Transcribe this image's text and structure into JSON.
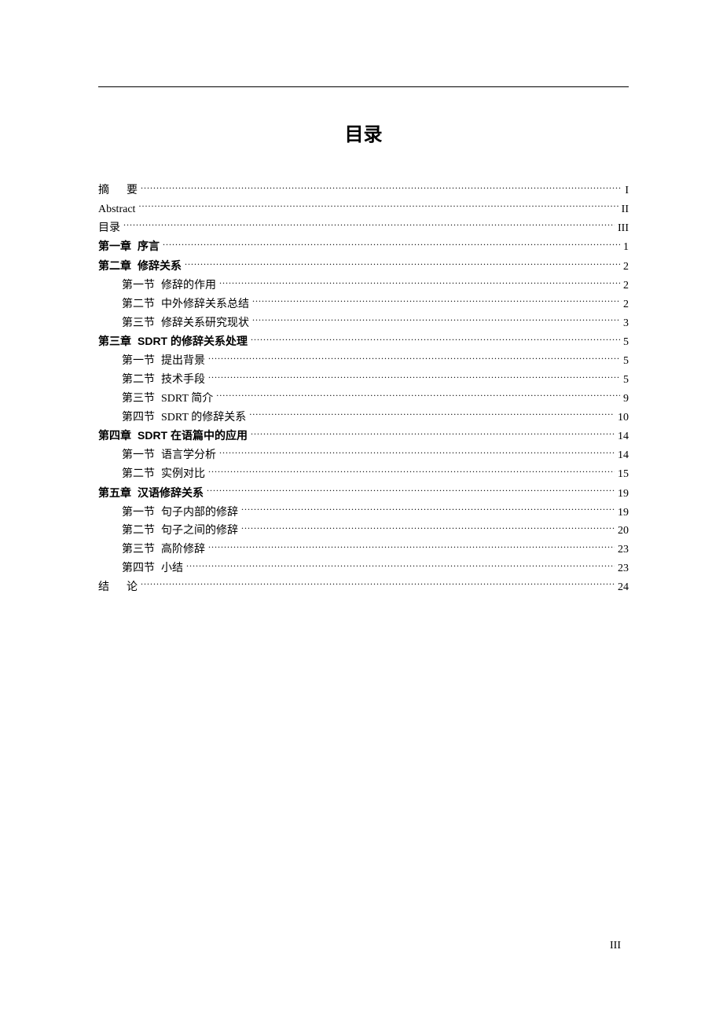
{
  "title": "目录",
  "page_number": "III",
  "entries": [
    {
      "label": "摘",
      "text": "要",
      "page": "I",
      "indent": 0,
      "bold": false,
      "spaced": true
    },
    {
      "label": "Abstract",
      "text": "",
      "page": "II",
      "indent": 0,
      "bold": false,
      "spaced": false
    },
    {
      "label": "目录",
      "text": "",
      "page": "III",
      "indent": 0,
      "bold": false,
      "spaced": false
    },
    {
      "label": "第一章",
      "text": "序言",
      "page": "1",
      "indent": 0,
      "bold": true,
      "spaced": false
    },
    {
      "label": "第二章",
      "text": "修辞关系",
      "page": "2",
      "indent": 0,
      "bold": true,
      "spaced": false
    },
    {
      "label": "第一节",
      "text": "修辞的作用",
      "page": "2",
      "indent": 1,
      "bold": false,
      "spaced": false
    },
    {
      "label": "第二节",
      "text": "中外修辞关系总结",
      "page": "2",
      "indent": 1,
      "bold": false,
      "spaced": false
    },
    {
      "label": "第三节",
      "text": "修辞关系研究现状",
      "page": "3",
      "indent": 1,
      "bold": false,
      "spaced": false
    },
    {
      "label": "第三章",
      "text": "SDRT 的修辞关系处理",
      "page": "5",
      "indent": 0,
      "bold": true,
      "spaced": false
    },
    {
      "label": "第一节",
      "text": "提出背景",
      "page": "5",
      "indent": 1,
      "bold": false,
      "spaced": false
    },
    {
      "label": "第二节",
      "text": "技术手段",
      "page": "5",
      "indent": 1,
      "bold": false,
      "spaced": false
    },
    {
      "label": "第三节",
      "text": "SDRT 简介",
      "page": "9",
      "indent": 1,
      "bold": false,
      "spaced": false
    },
    {
      "label": "第四节",
      "text": "SDRT 的修辞关系",
      "page": "10",
      "indent": 1,
      "bold": false,
      "spaced": false
    },
    {
      "label": "第四章",
      "text": "SDRT 在语篇中的应用",
      "page": "14",
      "indent": 0,
      "bold": true,
      "spaced": false
    },
    {
      "label": "第一节",
      "text": "语言学分析",
      "page": "14",
      "indent": 1,
      "bold": false,
      "spaced": false
    },
    {
      "label": "第二节",
      "text": "实例对比",
      "page": "15",
      "indent": 1,
      "bold": false,
      "spaced": false
    },
    {
      "label": "第五章",
      "text": "汉语修辞关系",
      "page": "19",
      "indent": 0,
      "bold": true,
      "spaced": false
    },
    {
      "label": "第一节",
      "text": "句子内部的修辞",
      "page": "19",
      "indent": 1,
      "bold": false,
      "spaced": false
    },
    {
      "label": "第二节",
      "text": "句子之间的修辞",
      "page": "20",
      "indent": 1,
      "bold": false,
      "spaced": false
    },
    {
      "label": "第三节",
      "text": "高阶修辞",
      "page": "23",
      "indent": 1,
      "bold": false,
      "spaced": false
    },
    {
      "label": "第四节",
      "text": "小结",
      "page": "23",
      "indent": 1,
      "bold": false,
      "spaced": false
    },
    {
      "label": "结",
      "text": "论",
      "page": "24",
      "indent": 0,
      "bold": false,
      "spaced": true
    }
  ]
}
